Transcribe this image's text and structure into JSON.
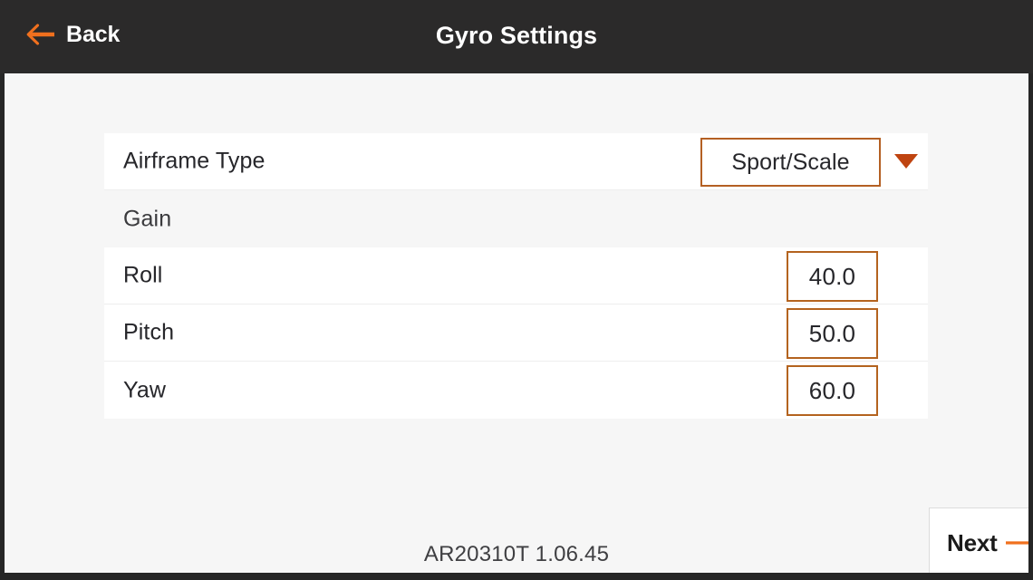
{
  "header": {
    "back_label": "Back",
    "back_icon": "arrow-left-icon",
    "title": "Gyro Settings"
  },
  "settings": {
    "airframe": {
      "label": "Airframe Type",
      "value": "Sport/Scale",
      "caret_icon": "chevron-down-icon"
    },
    "section_gain": {
      "label": "Gain"
    },
    "gain_rows": [
      {
        "label": "Roll",
        "value": "40.0"
      },
      {
        "label": "Pitch",
        "value": "50.0"
      },
      {
        "label": "Yaw",
        "value": "60.0"
      }
    ]
  },
  "footer": {
    "version": "AR20310T 1.06.45",
    "next_label": "Next",
    "next_icon": "arrow-right-icon"
  },
  "colors": {
    "accent_orange": "#f0701e",
    "field_border": "#b4631f",
    "caret_orange": "#bf4410",
    "titlebar_bg": "#2b2a2a",
    "page_bg": "#f6f6f6",
    "row_bg": "#ffffff",
    "text_dark": "#26262a"
  }
}
